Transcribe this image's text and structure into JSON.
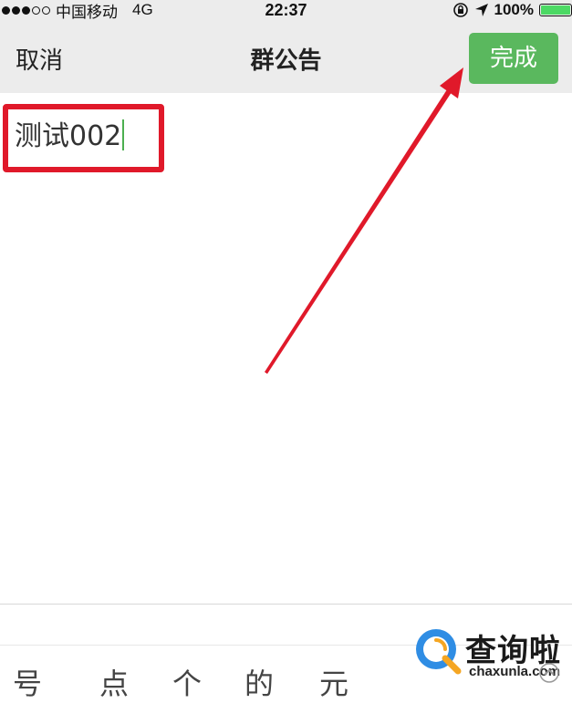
{
  "status_bar": {
    "carrier": "中国移动",
    "network": "4G",
    "time": "22:37",
    "battery": "100%",
    "battery_color": "#4cd964"
  },
  "nav": {
    "cancel_label": "取消",
    "title": "群公告",
    "done_label": "完成",
    "done_color": "#5ab85e"
  },
  "editor": {
    "text": "测试002"
  },
  "annotation": {
    "color": "#e0192a"
  },
  "keyboard": {
    "candidates": [
      "号",
      "点",
      "个",
      "的",
      "元"
    ]
  },
  "watermark": {
    "title": "查询啦",
    "url": "chaxunla.com"
  }
}
